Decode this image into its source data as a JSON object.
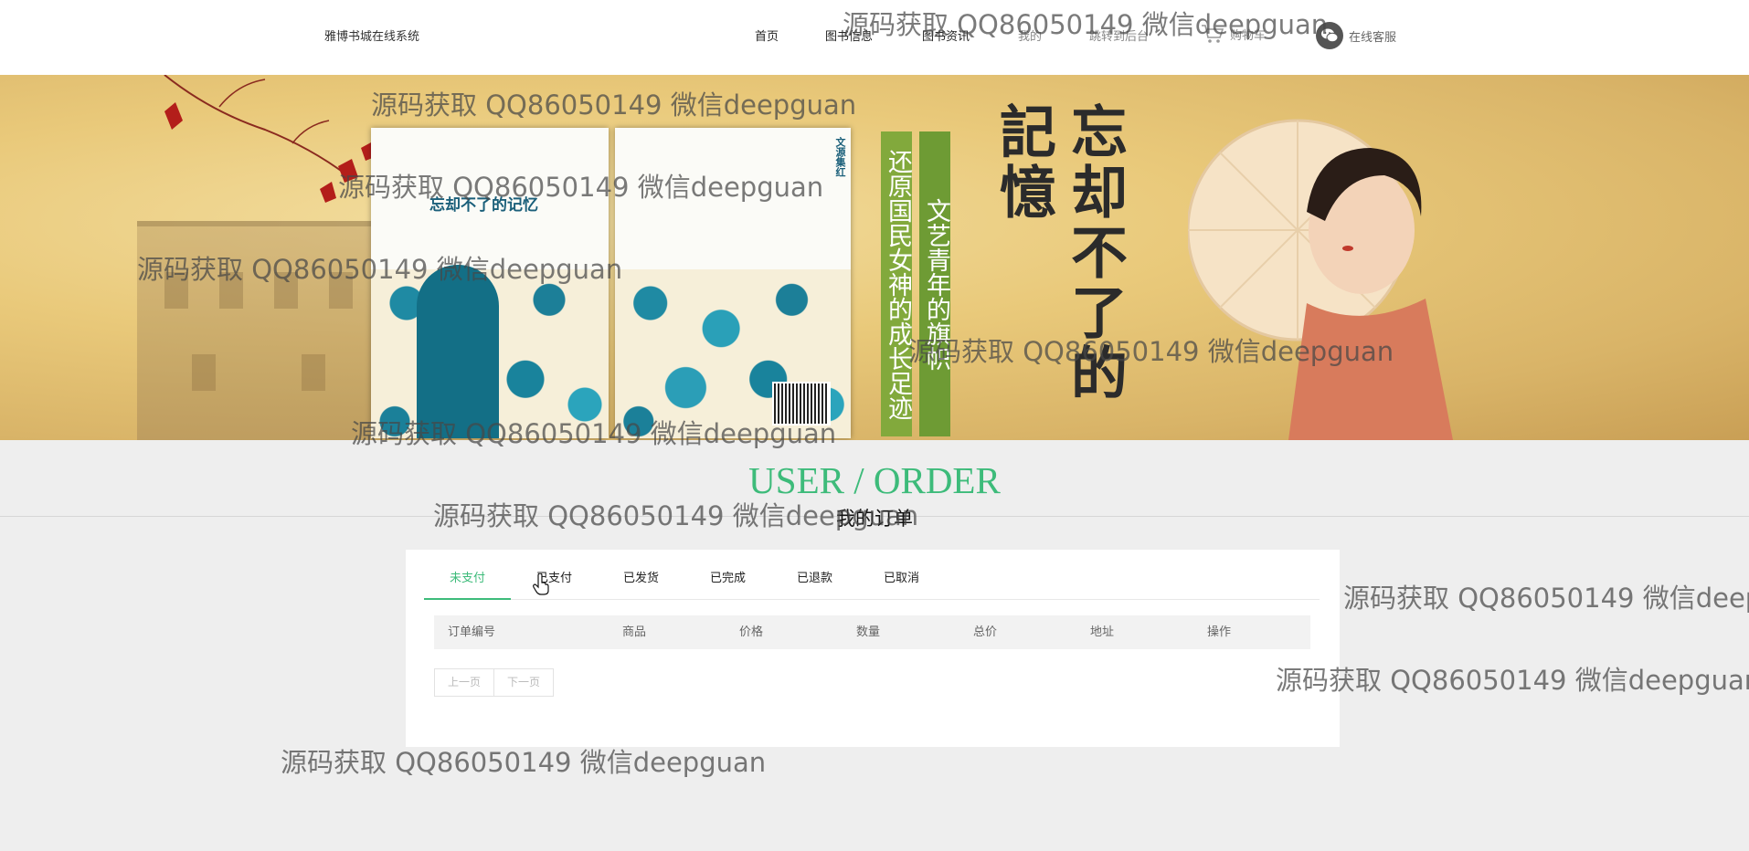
{
  "header": {
    "brand": "雅博书城在线系统",
    "nav": [
      "首页",
      "图书信息",
      "图书资讯",
      "我的",
      "跳转到后台"
    ],
    "cart_label": "购物车",
    "service_label": "在线客服"
  },
  "banner": {
    "cover_title": "忘却不了的记忆",
    "cover_spine": "文源集红",
    "green_text_1": "文艺青年的旗帜",
    "green_text_2": "还原国民女神的成长足迹",
    "big_title": "忘却不了的記憶"
  },
  "orders": {
    "heading": "USER / ORDER",
    "subheading": "我的订单",
    "tabs": [
      "未支付",
      "已支付",
      "已发货",
      "已完成",
      "已退款",
      "已取消"
    ],
    "active_tab": "未支付",
    "columns": [
      "订单编号",
      "商品",
      "价格",
      "数量",
      "总价",
      "地址",
      "操作"
    ],
    "pager": {
      "prev": "上一页",
      "next": "下一页"
    }
  },
  "watermark": "源码获取 QQ86050149 微信deepguan",
  "colors": {
    "accent": "#3dbb7a",
    "strip_green": "#6e9b34"
  }
}
